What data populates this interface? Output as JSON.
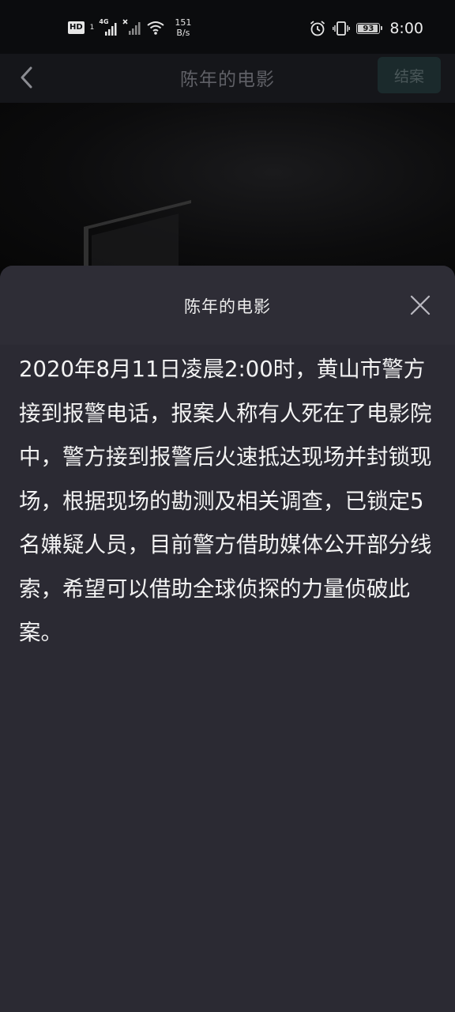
{
  "status_bar": {
    "hd_label": "HD",
    "hd_sub": "1",
    "network_type": "4G",
    "net_speed_value": "151",
    "net_speed_unit": "B/s",
    "battery_level": "93",
    "time": "8:00",
    "icons": [
      "hd-icon",
      "signal-4g-icon",
      "signal-no-sim-icon",
      "wifi-icon",
      "alarm-icon",
      "vibrate-icon",
      "battery-icon"
    ]
  },
  "nav": {
    "title": "陈年的电影",
    "back_icon": "chevron-left-icon",
    "close_case_label": "结案"
  },
  "sheet": {
    "title": "陈年的电影",
    "close_icon": "close-icon",
    "description": "2020年8月11日凌晨2:00时，黄山市警方接到报警电话，报案人称有人死在了电影院中，警方接到报警后火速抵达现场并封锁现场，根据现场的勘测及相关调查，已锁定5名嫌疑人员，目前警方借助媒体公开部分线索，希望可以借助全球侦探的力量侦破此案。"
  },
  "colors": {
    "status_bar_bg": "#0b0c0e",
    "nav_bg": "#15161a",
    "nav_title": "#5f6066",
    "close_case_bg": "#1b2a2c",
    "close_case_text": "#4a5759",
    "sheet_bg": "#2b2a33",
    "sheet_text": "#f3f3f3"
  }
}
